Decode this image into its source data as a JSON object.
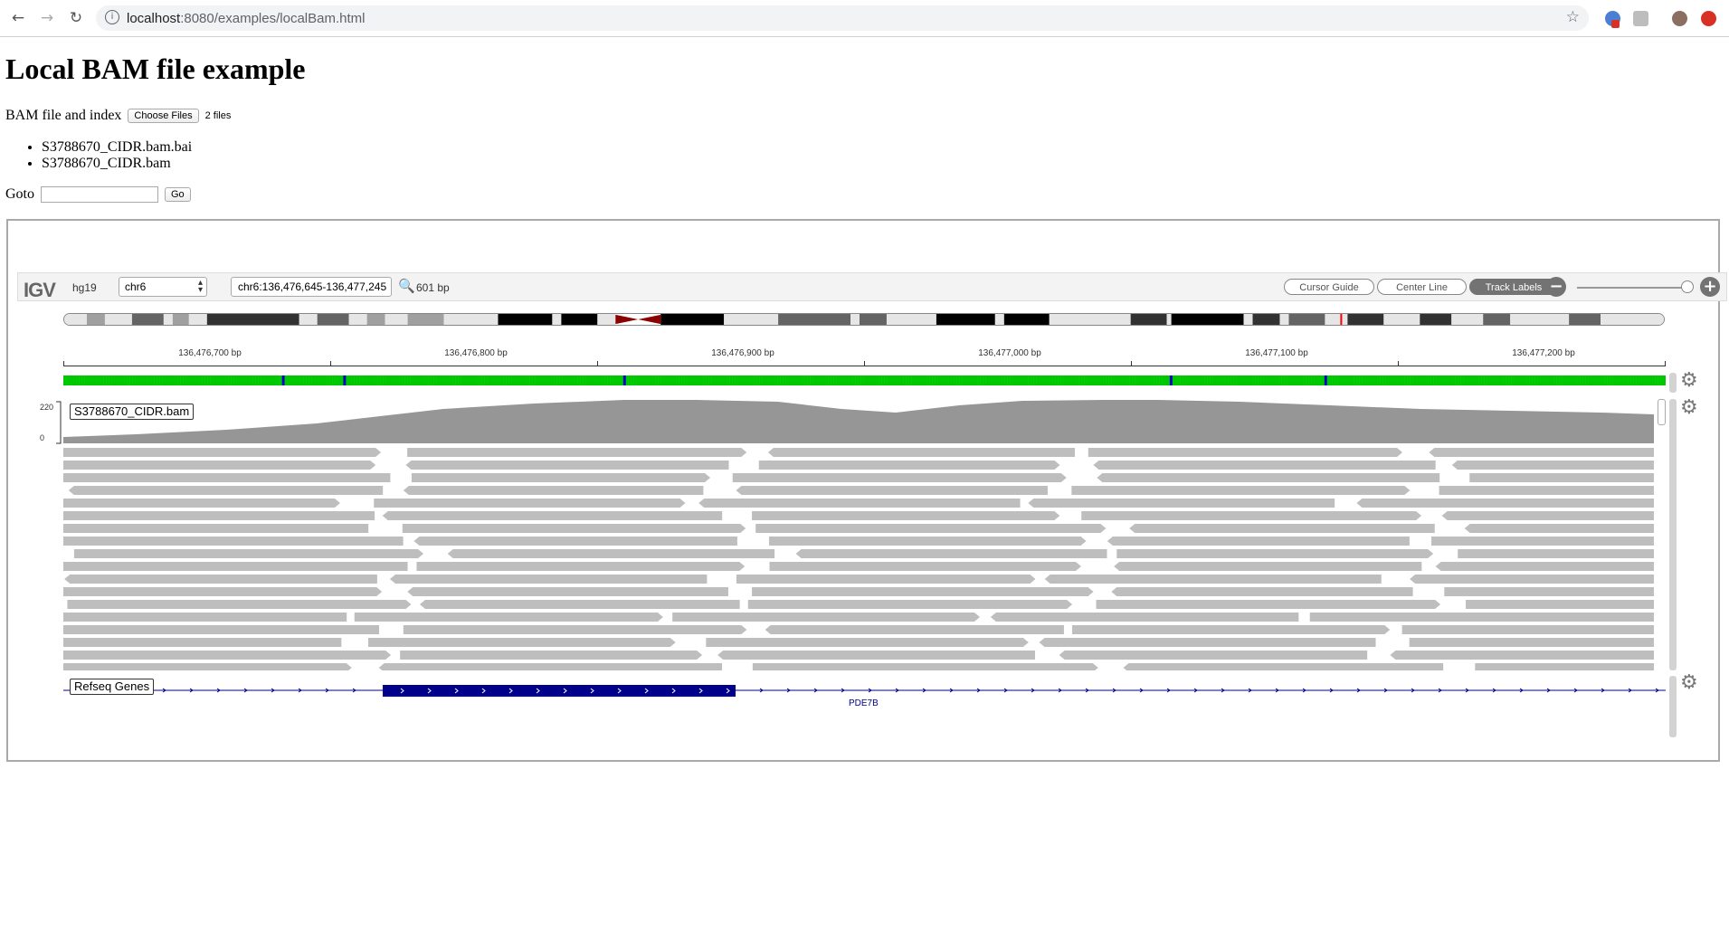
{
  "browser": {
    "url_host": "localhost",
    "url_path": ":8080/examples/localBam.html",
    "back_glyph": "←",
    "forward_glyph": "→",
    "reload_glyph": "↻",
    "star_glyph": "☆"
  },
  "page": {
    "title": "Local BAM file example",
    "file_label": "BAM file and index",
    "choose_button": "Choose Files",
    "file_count": "2 files",
    "files": [
      "S3788670_CIDR.bam.bai",
      "S3788670_CIDR.bam"
    ],
    "goto_label": "Goto",
    "go_button": "Go"
  },
  "igv": {
    "logo": "IGV",
    "genome": "hg19",
    "chromosome": "chr6",
    "locus": "chr6:136,476,645-136,477,245",
    "search_glyph": "🔍",
    "width_label": "601 bp",
    "cursor_guide": "Cursor Guide",
    "center_line": "Center Line",
    "track_labels": "Track Labels",
    "zoom_out": "−",
    "zoom_in": "+",
    "gear_glyph": "⚙",
    "ruler_labels": [
      "136,476,700 bp",
      "136,476,800 bp",
      "136,476,900 bp",
      "136,477,000 bp",
      "136,477,100 bp",
      "136,477,200 bp"
    ],
    "bam_track": {
      "name": "S3788670_CIDR.bam",
      "scale_max": "220",
      "scale_min": "0"
    },
    "gene_track": {
      "name": "Refseq Genes",
      "gene": "PDE7B"
    },
    "colors": {
      "A": "#00c800",
      "C": "#0000c8",
      "G": "#d17105",
      "T": "#ff0000",
      "coverage": "#969696",
      "read": "#bebebe",
      "gene": "#00008b"
    }
  }
}
